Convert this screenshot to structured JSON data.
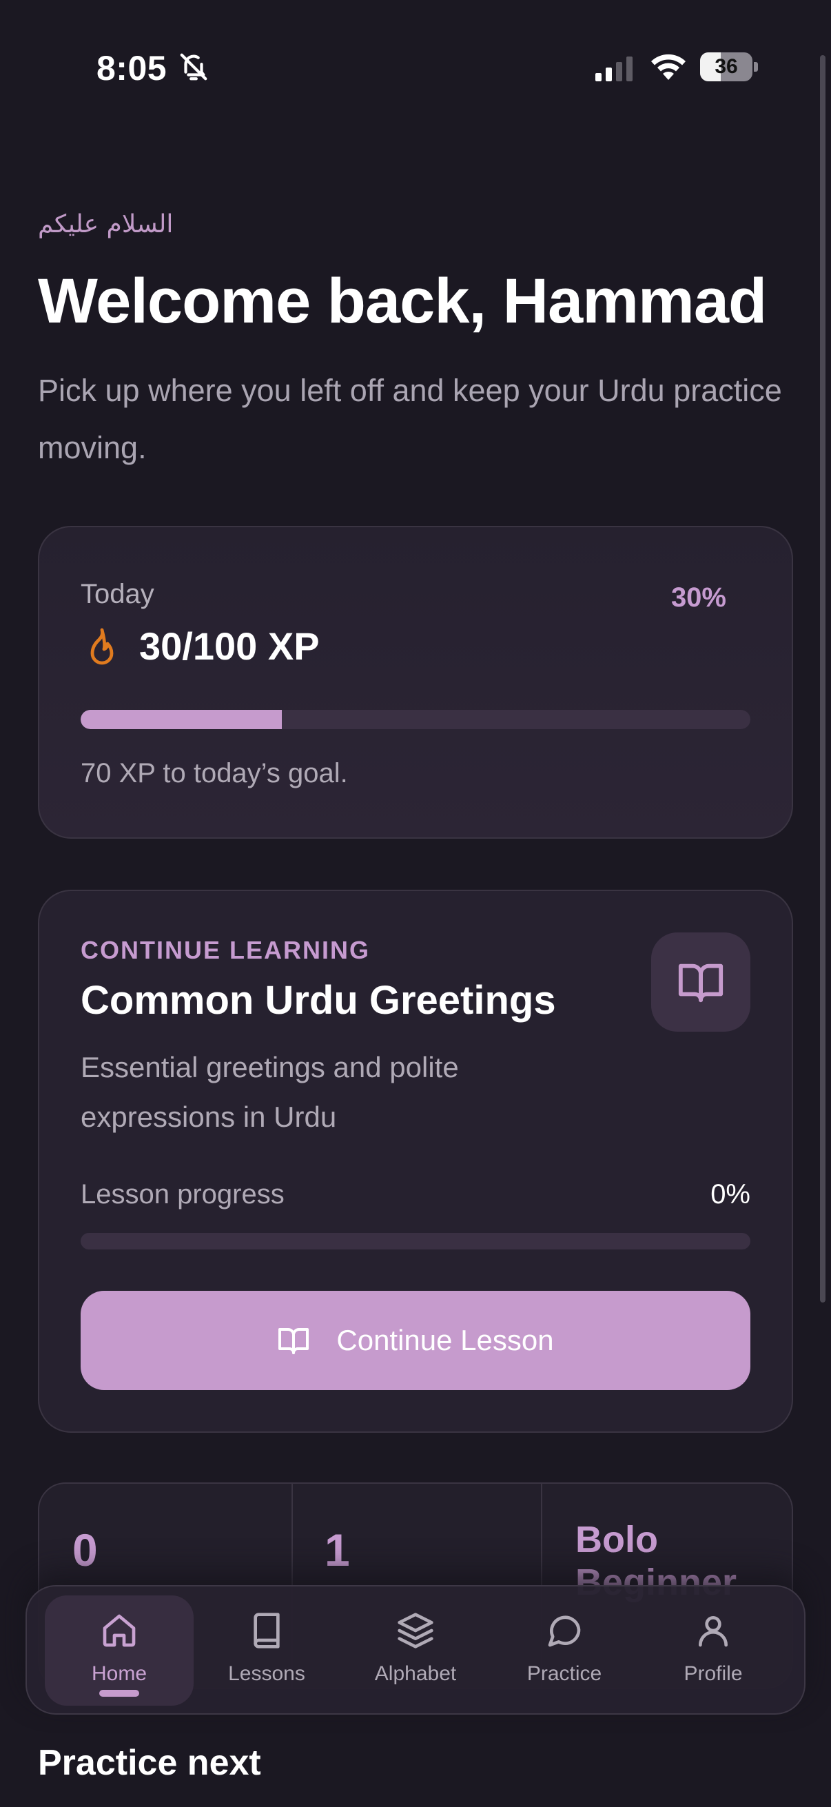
{
  "status_bar": {
    "time": "8:05",
    "battery": "36"
  },
  "header": {
    "greeting_urdu": "السلام علیکم",
    "title": "Welcome back, Hammad",
    "subtitle": "Pick up where you left off and keep your Urdu practice moving."
  },
  "xp_card": {
    "label": "Today",
    "value": "30/100 XP",
    "percent": "30%",
    "progress": 0.3,
    "goal_text": "70 XP to today’s goal."
  },
  "lesson_card": {
    "kicker": "CONTINUE LEARNING",
    "title": "Common Urdu Greetings",
    "description": "Essential greetings and polite expressions in Urdu",
    "progress_label": "Lesson progress",
    "progress_value": "0%",
    "progress": 0,
    "button_label": "Continue Lesson"
  },
  "stats": [
    {
      "value": "0"
    },
    {
      "value": "1"
    },
    {
      "value": "Bolo Beginner"
    }
  ],
  "nav": {
    "active": "Home",
    "items": [
      {
        "label": "Home",
        "icon": "home-icon"
      },
      {
        "label": "Lessons",
        "icon": "book-icon"
      },
      {
        "label": "Alphabet",
        "icon": "layers-icon"
      },
      {
        "label": "Practice",
        "icon": "chat-bubble-icon"
      },
      {
        "label": "Profile",
        "icon": "user-icon"
      }
    ]
  },
  "sections": {
    "practice_next": "Practice next"
  },
  "colors": {
    "background": "#1b1822",
    "card": "#26212f",
    "accent": "#c69bcd",
    "flame": "#e07b1f"
  }
}
